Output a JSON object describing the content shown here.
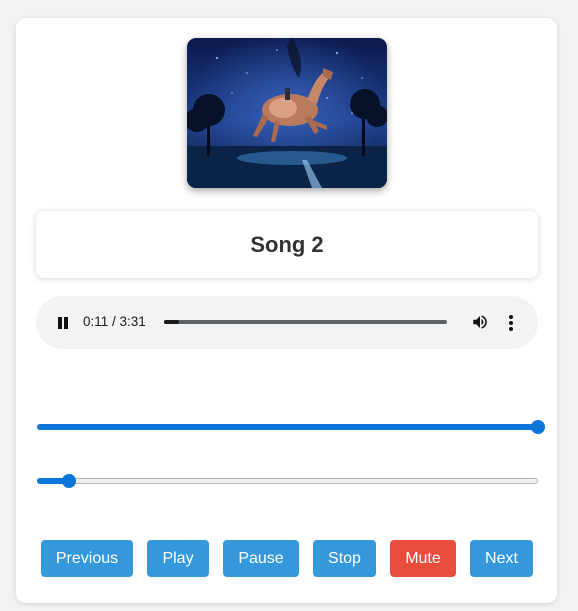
{
  "song": {
    "title": "Song 2"
  },
  "player": {
    "time_display": "0:11 / 3:31",
    "progress": 0.052
  },
  "sliders": {
    "volume_level": 1.0,
    "seek_level": 0.063
  },
  "controls": {
    "previous_label": "Previous",
    "play_label": "Play",
    "pause_label": "Pause",
    "stop_label": "Stop",
    "mute_label": "Mute",
    "next_label": "Next"
  },
  "colors": {
    "button": "#3498db",
    "mute_button": "#e74c3c",
    "slider_accent": "#0b75d9"
  },
  "icons": {
    "pause": "pause-icon",
    "volume": "volume-icon",
    "menu": "more-vert-icon"
  }
}
